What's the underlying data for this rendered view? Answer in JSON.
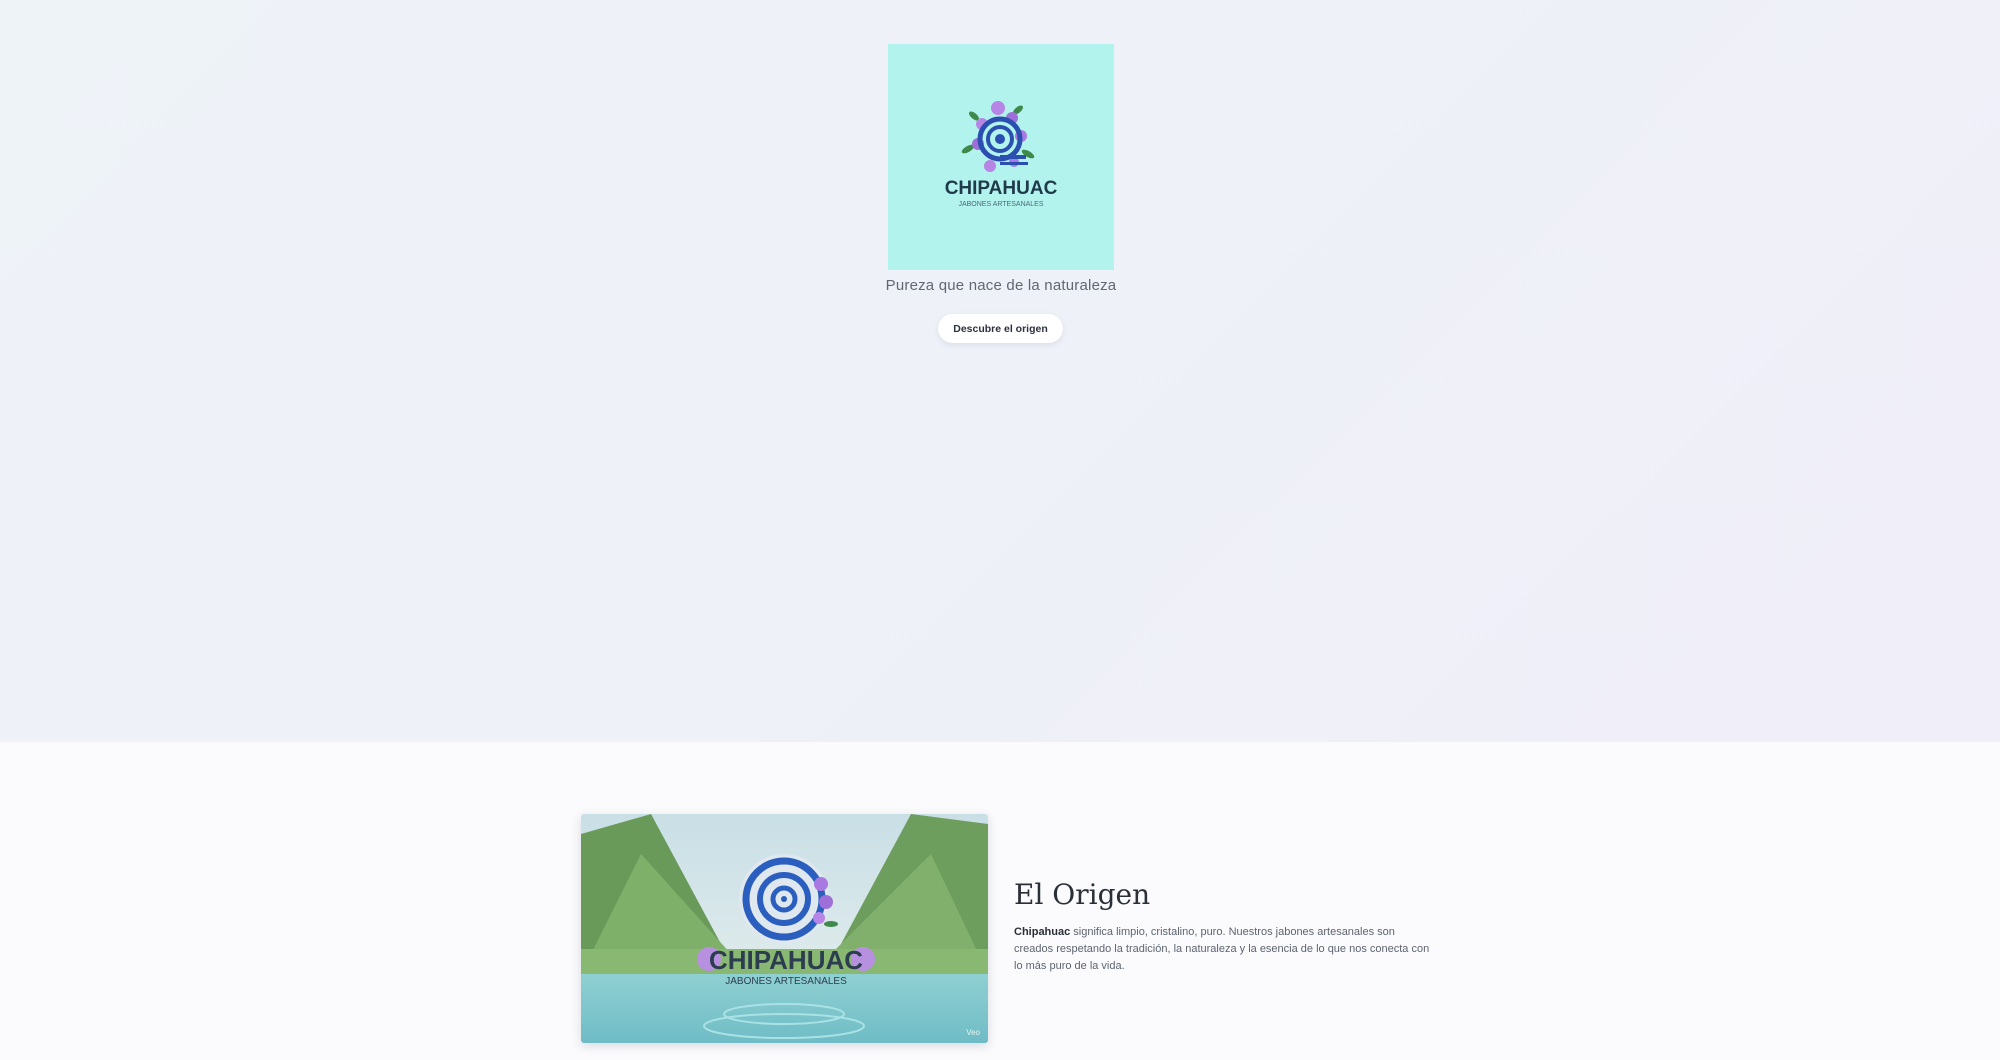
{
  "hero": {
    "logo": {
      "brand": "CHIPAHUAC",
      "subtitle": "JABONES ARTESANALES",
      "background_color": "#b3f3ee",
      "icon": "spiral-flowers-logo-icon"
    },
    "tagline": "Pureza que nace de la naturaleza",
    "cta_label": "Descubre el origen"
  },
  "origin": {
    "image": {
      "brand": "CHIPAHUAC",
      "subtitle": "JABONES ARTESANALES",
      "watermark": "Veo",
      "description_icon": "mountain-lake-logo-icon"
    },
    "title": "El Origen",
    "body_bold": "Chipahuac",
    "body_rest": " significa limpio, cristalino, puro. Nuestros jabones artesanales son creados respetando la tradición, la naturaleza y la esencia de lo que nos conecta con lo más puro de la vida."
  },
  "colors": {
    "accent_blue": "#2a4fb0",
    "flower_purple": "#a978e0",
    "leaf_green": "#3f8a4a"
  }
}
